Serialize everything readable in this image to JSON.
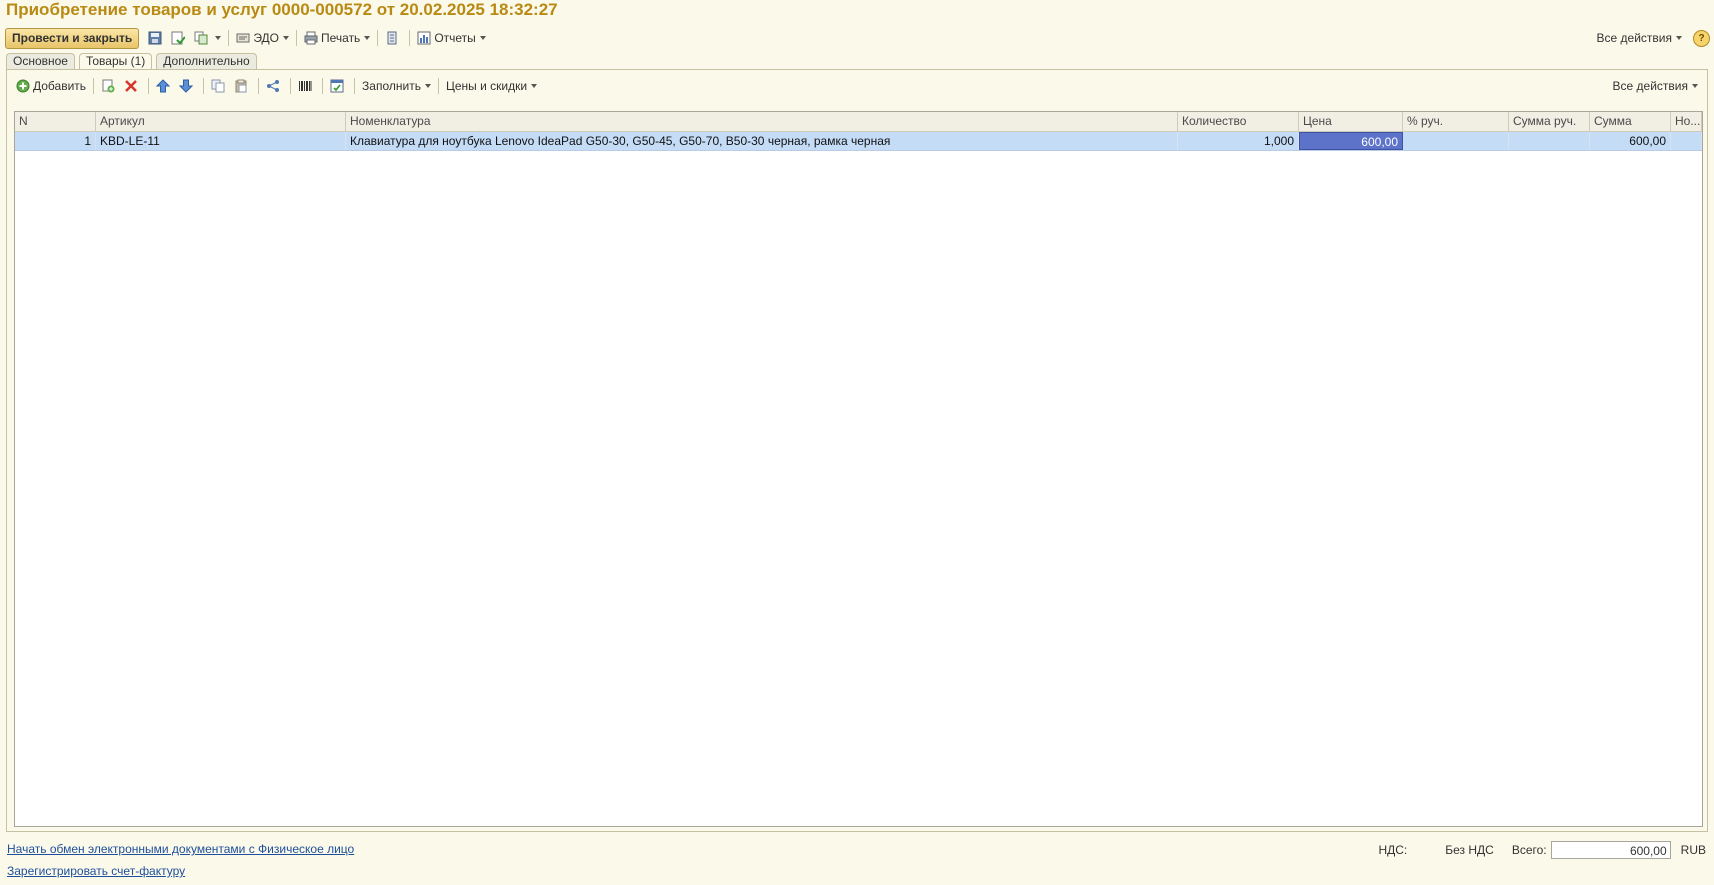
{
  "title": "Приобретение товаров и услуг 0000-000572 от 20.02.2025 18:32:27",
  "toolbar": {
    "post_close": "Провести и закрыть",
    "edo": "ЭДО",
    "print": "Печать",
    "reports": "Отчеты",
    "all_actions": "Все действия",
    "help": "?"
  },
  "tabs": [
    {
      "label": "Основное"
    },
    {
      "label": "Товары (1)",
      "active": true
    },
    {
      "label": "Дополнительно"
    }
  ],
  "table_toolbar": {
    "add": "Добавить",
    "fill": "Заполнить",
    "prices": "Цены и скидки",
    "all_actions": "Все действия"
  },
  "grid": {
    "columns": [
      "N",
      "Артикул",
      "Номенклатура",
      "Количество",
      "Цена",
      "% руч.",
      "Сумма руч.",
      "Сумма",
      "Но..."
    ],
    "rows": [
      {
        "n": "1",
        "article": "KBD-LE-11",
        "item": "Клавиатура для ноутбука Lenovo IdeaPad G50-30, G50-45, G50-70, B50-30 черная, рамка черная",
        "qty": "1,000",
        "price": "600,00",
        "pct_manual": "",
        "sum_manual": "",
        "sum": "600,00",
        "extra": ""
      }
    ]
  },
  "footer": {
    "link_edo": "Начать обмен электронными документами с Физическое лицо",
    "link_invoice": "Зарегистрировать счет-фактуру",
    "vat_label": "НДС:",
    "vat_value": "Без НДС",
    "total_label": "Всего:",
    "total_value": "600,00",
    "currency": "RUB"
  }
}
